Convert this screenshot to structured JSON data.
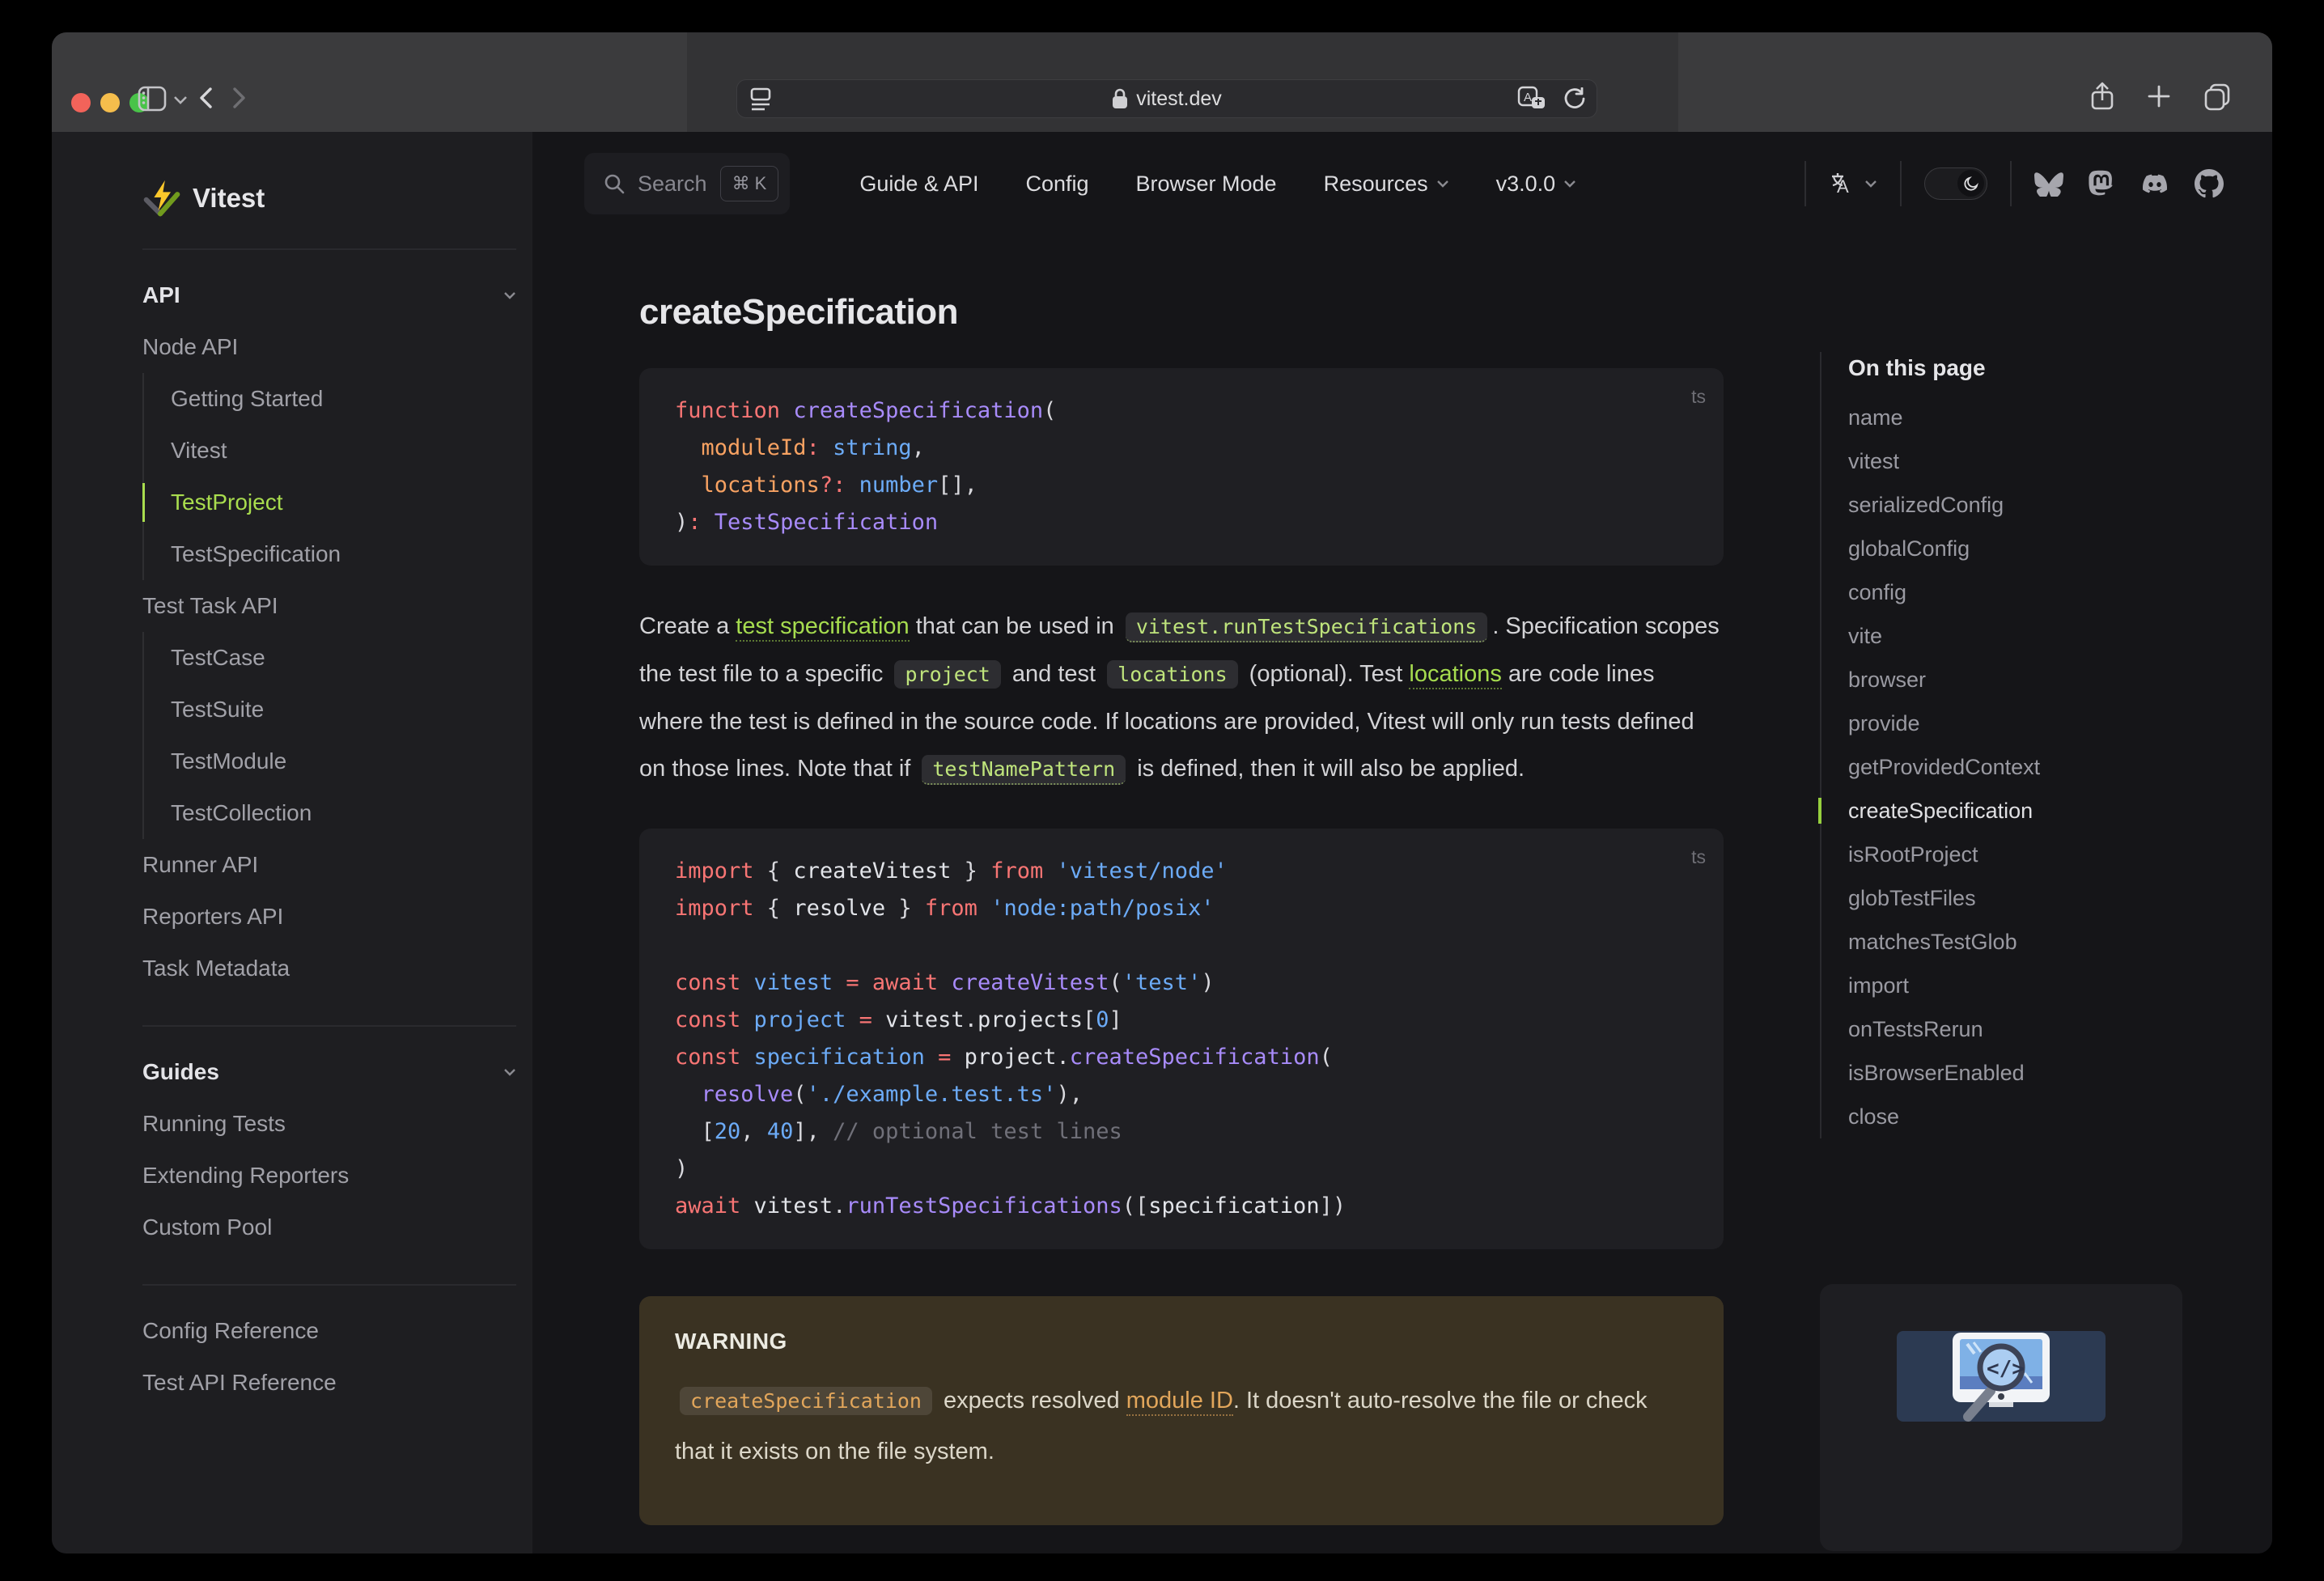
{
  "browser": {
    "url": "vitest.dev",
    "traffic_lights": [
      "close",
      "minimize",
      "zoom"
    ],
    "icons": [
      "sidebar-toggle-icon",
      "chevron-down-icon",
      "back-icon",
      "forward-icon",
      "reader-icon",
      "lock-icon",
      "translate-icon",
      "reload-icon",
      "share-icon",
      "new-tab-icon",
      "tab-overview-icon"
    ]
  },
  "nav": {
    "search_label": "Search",
    "search_kbd": "⌘ K",
    "links": [
      "Guide & API",
      "Config",
      "Browser Mode"
    ],
    "dropdowns": [
      "Resources",
      "v3.0.0"
    ],
    "icons": [
      "language-icon",
      "theme-toggle-moon-icon"
    ],
    "socials": [
      "bluesky",
      "mastodon",
      "discord",
      "github"
    ]
  },
  "sidebar": {
    "brand": "Vitest",
    "sections": [
      {
        "title": "API",
        "items": [
          {
            "label": "Node API"
          },
          {
            "label": "Getting Started",
            "nested": true
          },
          {
            "label": "Vitest",
            "nested": true
          },
          {
            "label": "TestProject",
            "nested": true,
            "active": true
          },
          {
            "label": "TestSpecification",
            "nested": true
          },
          {
            "label": "Test Task API"
          },
          {
            "label": "TestCase",
            "nested": true
          },
          {
            "label": "TestSuite",
            "nested": true
          },
          {
            "label": "TestModule",
            "nested": true
          },
          {
            "label": "TestCollection",
            "nested": true
          },
          {
            "label": "Runner API"
          },
          {
            "label": "Reporters API"
          },
          {
            "label": "Task Metadata"
          }
        ]
      },
      {
        "title": "Guides",
        "items": [
          {
            "label": "Running Tests"
          },
          {
            "label": "Extending Reporters"
          },
          {
            "label": "Custom Pool"
          }
        ]
      },
      {
        "items": [
          {
            "label": "Config Reference"
          },
          {
            "label": "Test API Reference"
          }
        ]
      }
    ]
  },
  "content": {
    "heading": "createSpecification",
    "paragraph": [
      {
        "s": "text",
        "x": "Create a "
      },
      {
        "s": "link",
        "x": "test specification"
      },
      {
        "s": "text",
        "x": " that can be used in "
      },
      {
        "s": "codelink",
        "x": "vitest.runTestSpecifications"
      },
      {
        "s": "text",
        "x": ". Specification scopes the test file to a specific "
      },
      {
        "s": "code",
        "x": "project"
      },
      {
        "s": "text",
        "x": " and test "
      },
      {
        "s": "code",
        "x": "locations"
      },
      {
        "s": "text",
        "x": " (optional). Test "
      },
      {
        "s": "link",
        "x": "locations"
      },
      {
        "s": "text",
        "x": " are code lines where the test is defined in the source code. If locations are provided, Vitest will only run tests defined on those lines. Note that if "
      },
      {
        "s": "codelink",
        "x": "testNamePattern"
      },
      {
        "s": "text",
        "x": " is defined, then it will also be applied."
      }
    ],
    "warning": {
      "title": "WARNING",
      "runs": [
        {
          "s": "code",
          "x": "createSpecification"
        },
        {
          "s": "text",
          "x": " expects resolved "
        },
        {
          "s": "link",
          "x": "module ID"
        },
        {
          "s": "text",
          "x": ". It doesn't auto-resolve the file or check that it exists on the file system."
        }
      ]
    }
  },
  "code_blocks": [
    {
      "lang": "ts",
      "lines": [
        [
          [
            "k",
            "function "
          ],
          [
            "f",
            "createSpecification"
          ],
          [
            "d",
            "("
          ]
        ],
        [
          [
            "d",
            "  "
          ],
          [
            "p",
            "moduleId"
          ],
          [
            "k",
            ":"
          ],
          [
            "d",
            " "
          ],
          [
            "t",
            "string"
          ],
          [
            "d",
            ","
          ]
        ],
        [
          [
            "d",
            "  "
          ],
          [
            "p",
            "locations"
          ],
          [
            "k",
            "?:"
          ],
          [
            "d",
            " "
          ],
          [
            "t",
            "number"
          ],
          [
            "d",
            "[],"
          ]
        ],
        [
          [
            "d",
            ")"
          ],
          [
            "k",
            ":"
          ],
          [
            "d",
            " "
          ],
          [
            "f",
            "TestSpecification"
          ]
        ]
      ]
    },
    {
      "lang": "ts",
      "lines": [
        [
          [
            "k",
            "import"
          ],
          [
            "d",
            " { "
          ],
          [
            "w",
            "createVitest"
          ],
          [
            "d",
            " } "
          ],
          [
            "k",
            "from"
          ],
          [
            "d",
            " "
          ],
          [
            "s",
            "'vitest/node'"
          ]
        ],
        [
          [
            "k",
            "import"
          ],
          [
            "d",
            " { "
          ],
          [
            "w",
            "resolve"
          ],
          [
            "d",
            " } "
          ],
          [
            "k",
            "from"
          ],
          [
            "d",
            " "
          ],
          [
            "s",
            "'node:path/posix'"
          ]
        ],
        [],
        [
          [
            "k",
            "const"
          ],
          [
            "d",
            " "
          ],
          [
            "t",
            "vitest"
          ],
          [
            "d",
            " "
          ],
          [
            "k",
            "="
          ],
          [
            "d",
            " "
          ],
          [
            "k",
            "await"
          ],
          [
            "d",
            " "
          ],
          [
            "f",
            "createVitest"
          ],
          [
            "d",
            "("
          ],
          [
            "s",
            "'test'"
          ],
          [
            "d",
            ")"
          ]
        ],
        [
          [
            "k",
            "const"
          ],
          [
            "d",
            " "
          ],
          [
            "t",
            "project"
          ],
          [
            "d",
            " "
          ],
          [
            "k",
            "="
          ],
          [
            "d",
            " "
          ],
          [
            "w",
            "vitest"
          ],
          [
            "d",
            "."
          ],
          [
            "w",
            "projects"
          ],
          [
            "d",
            "["
          ],
          [
            "n",
            "0"
          ],
          [
            "d",
            "]"
          ]
        ],
        [
          [
            "k",
            "const"
          ],
          [
            "d",
            " "
          ],
          [
            "t",
            "specification"
          ],
          [
            "d",
            " "
          ],
          [
            "k",
            "="
          ],
          [
            "d",
            " "
          ],
          [
            "w",
            "project"
          ],
          [
            "d",
            "."
          ],
          [
            "f",
            "createSpecification"
          ],
          [
            "d",
            "("
          ]
        ],
        [
          [
            "d",
            "  "
          ],
          [
            "f",
            "resolve"
          ],
          [
            "d",
            "("
          ],
          [
            "s",
            "'./example.test.ts'"
          ],
          [
            "d",
            "),"
          ]
        ],
        [
          [
            "d",
            "  ["
          ],
          [
            "n",
            "20"
          ],
          [
            "d",
            ", "
          ],
          [
            "n",
            "40"
          ],
          [
            "d",
            "], "
          ],
          [
            "c",
            "// optional test lines"
          ]
        ],
        [
          [
            "d",
            ")"
          ]
        ],
        [
          [
            "k",
            "await"
          ],
          [
            "d",
            " "
          ],
          [
            "w",
            "vitest"
          ],
          [
            "d",
            "."
          ],
          [
            "f",
            "runTestSpecifications"
          ],
          [
            "d",
            "(["
          ],
          [
            "w",
            "specification"
          ],
          [
            "d",
            "])"
          ]
        ]
      ]
    }
  ],
  "aside": {
    "title": "On this page",
    "items": [
      "name",
      "vitest",
      "serializedConfig",
      "globalConfig",
      "config",
      "vite",
      "browser",
      "provide",
      "getProvidedContext",
      "createSpecification",
      "isRootProject",
      "globTestFiles",
      "matchesTestGlob",
      "import",
      "onTestsRerun",
      "isBrowserEnabled",
      "close"
    ],
    "active": "createSpecification",
    "ad_icon": "code-magnifier-monitor-illustration"
  },
  "colors": {
    "accent_green": "#a9dd4e",
    "code_keyword": "#f87574",
    "code_function": "#a88bfa",
    "code_param": "#f8a262",
    "code_literal": "#6cabf7",
    "warning_bg": "#3a3222",
    "warning_accent": "#e2a65b"
  }
}
